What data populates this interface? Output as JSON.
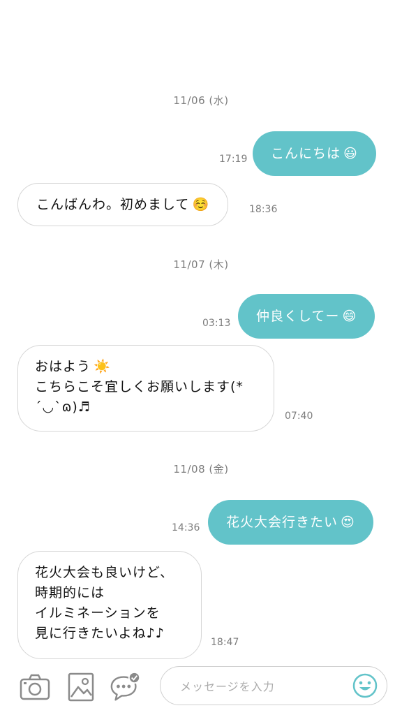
{
  "chat": {
    "days": [
      {
        "date": "11/06 (水)",
        "messages": [
          {
            "side": "out",
            "lines": [
              "こんにちは"
            ],
            "emoji": "😃",
            "time": "17:19"
          },
          {
            "side": "in",
            "lines": [
              "こんばんわ。初めまして"
            ],
            "emoji": "☺️",
            "time": "18:36"
          }
        ]
      },
      {
        "date": "11/07 (木)",
        "messages": [
          {
            "side": "out",
            "lines": [
              "仲良くしてー"
            ],
            "emoji": "😄",
            "time": "03:13"
          },
          {
            "side": "in",
            "lines": [
              "おはよう",
              "こちらこそ宜しくお願いします(*",
              "´◡`ɷ)♬"
            ],
            "emoji": "☀️",
            "time": "07:40"
          }
        ]
      },
      {
        "date": "11/08 (金)",
        "messages": [
          {
            "side": "out",
            "lines": [
              "花火大会行きたい"
            ],
            "emoji": "😍",
            "time": "14:36"
          },
          {
            "side": "in",
            "lines": [
              "花火大会も良いけど、",
              "時期的には",
              "イルミネーションを",
              "見に行きたいよね♪♪"
            ],
            "emoji": "",
            "time": "18:47"
          }
        ]
      }
    ]
  },
  "composer": {
    "placeholder": "メッセージを入力",
    "icons": [
      "camera-icon",
      "image-icon",
      "chat-bubble-check-icon",
      "smile-icon"
    ],
    "accent": "#62c3c9"
  }
}
